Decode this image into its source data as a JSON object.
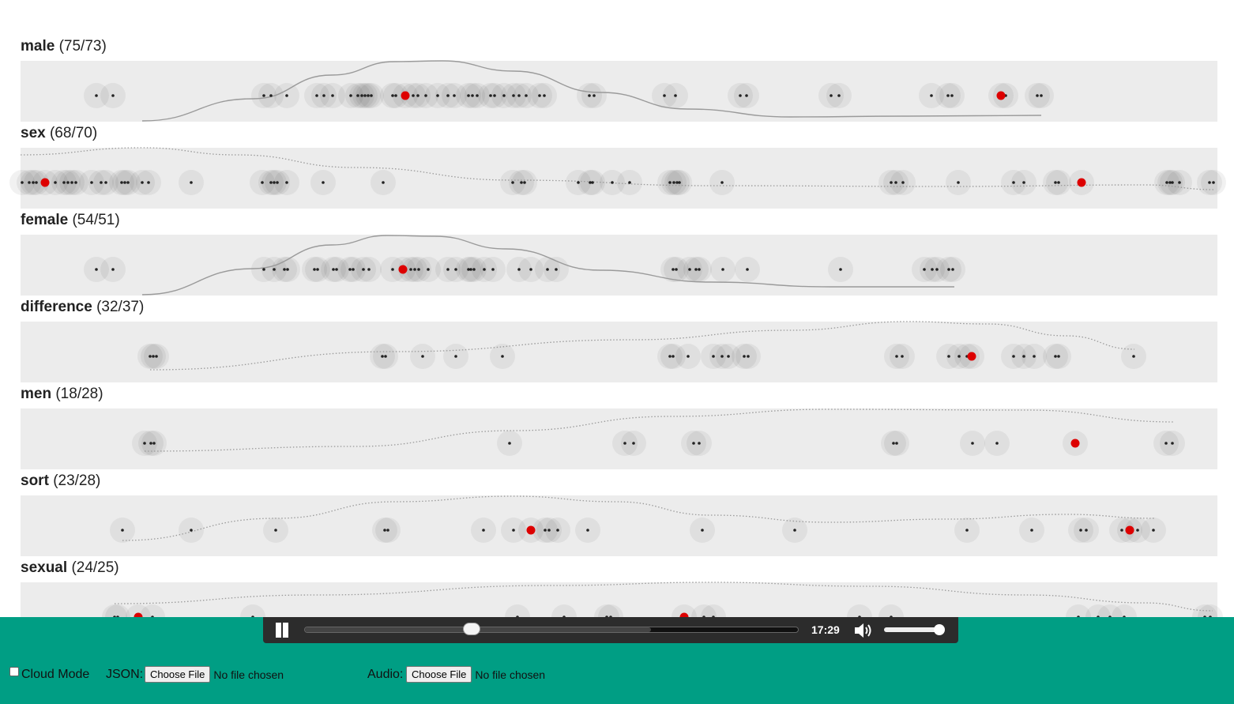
{
  "tracks": [
    {
      "word": "male",
      "counts": "(75/73)",
      "dots": [
        122,
        143,
        334,
        343,
        363,
        401,
        410,
        421,
        444,
        453,
        458,
        462,
        466,
        470,
        497,
        501,
        513,
        523,
        529,
        539,
        554,
        567,
        575,
        593,
        598,
        604,
        621,
        626,
        638,
        650,
        657,
        666,
        683,
        689,
        746,
        752,
        841,
        855,
        937,
        945,
        1052,
        1062,
        1179,
        1200,
        1205,
        1267,
        1273,
        1313,
        1318
      ],
      "active": [
        513,
        1267
      ],
      "curve": {
        "style": "solid",
        "pts": [
          [
            180,
            153
          ],
          [
            320,
            125
          ],
          [
            420,
            95
          ],
          [
            500,
            78
          ],
          [
            560,
            77
          ],
          [
            650,
            90
          ],
          [
            760,
            117
          ],
          [
            870,
            138
          ],
          [
            1000,
            148
          ],
          [
            1150,
            147
          ],
          [
            1318,
            146
          ]
        ]
      }
    },
    {
      "word": "sex",
      "counts": "(68/70)",
      "dots": [
        28,
        37,
        42,
        46,
        57,
        70,
        81,
        86,
        91,
        96,
        116,
        128,
        134,
        154,
        158,
        162,
        180,
        188,
        242,
        332,
        343,
        347,
        351,
        363,
        409,
        485,
        649,
        660,
        664,
        732,
        747,
        750,
        775,
        797,
        848,
        853,
        857,
        860,
        914,
        1128,
        1134,
        1143,
        1213,
        1283,
        1296,
        1336,
        1340,
        1369,
        1477,
        1481,
        1484,
        1493,
        1531,
        1536
      ],
      "active": [
        57,
        1369
      ],
      "curve": {
        "style": "dotted",
        "pts": [
          [
            26,
            196
          ],
          [
            180,
            187
          ],
          [
            300,
            196
          ],
          [
            450,
            212
          ],
          [
            650,
            228
          ],
          [
            900,
            235
          ],
          [
            1200,
            236
          ],
          [
            1450,
            234
          ],
          [
            1538,
            240
          ]
        ]
      }
    },
    {
      "word": "female",
      "counts": "(54/51)",
      "dots": [
        122,
        143,
        334,
        347,
        360,
        364,
        398,
        402,
        422,
        426,
        443,
        447,
        460,
        467,
        497,
        510,
        520,
        525,
        530,
        542,
        567,
        577,
        593,
        596,
        600,
        613,
        624,
        657,
        672,
        693,
        704,
        852,
        856,
        873,
        881,
        885,
        915,
        946,
        1064,
        1170,
        1180,
        1186,
        1201,
        1206
      ],
      "active": [
        510
      ],
      "curve": {
        "style": "solid",
        "pts": [
          [
            180,
            373
          ],
          [
            320,
            340
          ],
          [
            420,
            310
          ],
          [
            490,
            298
          ],
          [
            550,
            299
          ],
          [
            640,
            315
          ],
          [
            760,
            342
          ],
          [
            900,
            357
          ],
          [
            1050,
            363
          ],
          [
            1208,
            363
          ]
        ]
      }
    },
    {
      "word": "difference",
      "counts": "(32/37)",
      "dots": [
        190,
        194,
        198,
        484,
        488,
        535,
        577,
        636,
        848,
        852,
        871,
        903,
        914,
        922,
        942,
        947,
        1135,
        1142,
        1201,
        1214,
        1224,
        1230,
        1283,
        1296,
        1309,
        1336,
        1340,
        1435
      ],
      "active": [
        1230
      ],
      "curve": {
        "style": "dotted",
        "pts": [
          [
            190,
            468
          ],
          [
            500,
            445
          ],
          [
            800,
            430
          ],
          [
            1000,
            418
          ],
          [
            1150,
            407
          ],
          [
            1250,
            410
          ],
          [
            1350,
            425
          ],
          [
            1436,
            442
          ]
        ]
      }
    },
    {
      "word": "men",
      "counts": "(18/28)",
      "dots": [
        183,
        191,
        195,
        645,
        791,
        802,
        878,
        885,
        1131,
        1135,
        1231,
        1262,
        1361,
        1476,
        1484
      ],
      "active": [
        1361
      ],
      "curve": {
        "style": "dotted",
        "pts": [
          [
            183,
            571
          ],
          [
            450,
            565
          ],
          [
            650,
            545
          ],
          [
            850,
            527
          ],
          [
            1050,
            518
          ],
          [
            1300,
            519
          ],
          [
            1486,
            534
          ]
        ]
      }
    },
    {
      "word": "sort",
      "counts": "(23/28)",
      "dots": [
        155,
        242,
        349,
        487,
        491,
        612,
        650,
        672,
        690,
        695,
        706,
        744,
        889,
        1006,
        1224,
        1306,
        1368,
        1375,
        1420,
        1430,
        1440,
        1460
      ],
      "active": [
        672,
        1430
      ],
      "curve": {
        "style": "dotted",
        "pts": [
          [
            155,
            684
          ],
          [
            350,
            656
          ],
          [
            500,
            635
          ],
          [
            650,
            628
          ],
          [
            780,
            635
          ],
          [
            900,
            652
          ],
          [
            1050,
            661
          ],
          [
            1200,
            657
          ],
          [
            1350,
            651
          ],
          [
            1461,
            656
          ]
        ]
      }
    },
    {
      "word": "sexual",
      "counts": "(24/25)",
      "dots": [
        145,
        149,
        175,
        193,
        320,
        655,
        714,
        768,
        773,
        866,
        891,
        903,
        1088,
        1128,
        1365,
        1390,
        1405,
        1423,
        1525,
        1532
      ],
      "active": [
        175,
        866
      ],
      "curve": {
        "style": "dotted",
        "pts": [
          [
            145,
            764
          ],
          [
            400,
            753
          ],
          [
            700,
            741
          ],
          [
            900,
            737
          ],
          [
            1100,
            742
          ],
          [
            1300,
            753
          ],
          [
            1450,
            763
          ],
          [
            1535,
            773
          ]
        ]
      }
    }
  ],
  "player": {
    "time": "17:29",
    "progress": 0.337,
    "buffered": 0.7,
    "volume": 0.9
  },
  "controls": {
    "cloud_mode_label": "Cloud Mode",
    "json_label": "JSON:",
    "audio_label": "Audio:",
    "choose_file_label": "Choose File",
    "no_file_label": "No file chosen"
  },
  "colors": {
    "band": "#ececec",
    "active_dot": "#dd0000",
    "dot": "#222222",
    "controls_bg": "#009e84",
    "player_bg": "#2c2c2c"
  },
  "icons": {
    "play_pause": "pause-icon",
    "volume": "volume-icon"
  }
}
